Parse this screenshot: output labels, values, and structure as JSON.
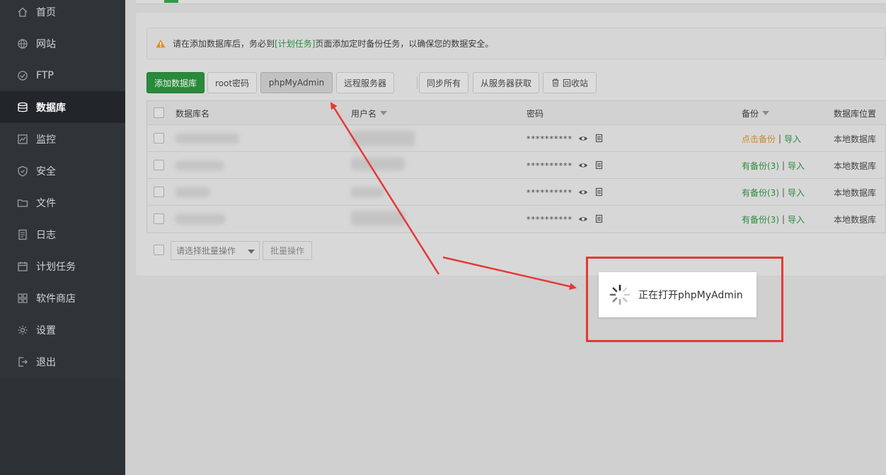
{
  "sidebar": {
    "items": [
      {
        "label": "首页",
        "icon": "home-icon"
      },
      {
        "label": "网站",
        "icon": "globe-icon"
      },
      {
        "label": "FTP",
        "icon": "ftp-icon"
      },
      {
        "label": "数据库",
        "icon": "database-icon",
        "active": true
      },
      {
        "label": "监控",
        "icon": "monitor-icon"
      },
      {
        "label": "安全",
        "icon": "shield-icon"
      },
      {
        "label": "文件",
        "icon": "folder-icon"
      },
      {
        "label": "日志",
        "icon": "log-icon"
      },
      {
        "label": "计划任务",
        "icon": "calendar-icon"
      },
      {
        "label": "软件商店",
        "icon": "apps-icon"
      },
      {
        "label": "设置",
        "icon": "gear-icon"
      },
      {
        "label": "退出",
        "icon": "logout-icon"
      }
    ]
  },
  "alert": {
    "prefix": "请在添加数据库后，务必到",
    "link": "[计划任务]",
    "suffix": "页面添加定时备份任务，以确保您的数据安全。"
  },
  "toolbar": {
    "add_db": "添加数据库",
    "root_password": "root密码",
    "phpmyadmin": "phpMyAdmin",
    "remote_server": "远程服务器",
    "sync_all": "同步所有",
    "fetch_from_server": "从服务器获取",
    "recycle_bin": "回收站"
  },
  "table": {
    "headers": {
      "name": "数据库名",
      "user": "用户名",
      "password": "密码",
      "backup": "备份",
      "location": "数据库位置"
    },
    "rows": [
      {
        "password": "**********",
        "backup": "点击备份",
        "backup_state": "none",
        "import": "导入",
        "location": "本地数据库"
      },
      {
        "password": "**********",
        "backup": "有备份(3)",
        "backup_state": "has",
        "import": "导入",
        "location": "本地数据库"
      },
      {
        "password": "**********",
        "backup": "有备份(3)",
        "backup_state": "has",
        "import": "导入",
        "location": "本地数据库"
      },
      {
        "password": "**********",
        "backup": "有备份(3)",
        "backup_state": "has",
        "import": "导入",
        "location": "本地数据库"
      }
    ]
  },
  "batch": {
    "select_placeholder": "请选择批量操作",
    "button": "批量操作"
  },
  "loading": {
    "text": "正在打开phpMyAdmin"
  },
  "colors": {
    "accent_green": "#2a8a3c",
    "annotation_red": "#e53935",
    "backup_orange": "#c98a2e"
  }
}
